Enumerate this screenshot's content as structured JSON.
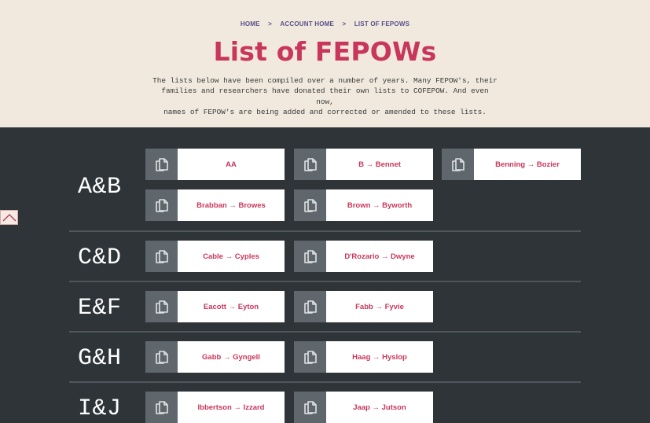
{
  "breadcrumb": {
    "home": "HOME",
    "account": "ACCOUNT HOME",
    "current": "LIST OF FEPOWS",
    "separator": ">"
  },
  "page_title": "List of FEPOWs",
  "intro": {
    "line1": "The lists below have been compiled over a number of years. Many FEPOW's, their",
    "line2": "families and researchers have donated their own lists to COFEPOW. And even now,",
    "line3": "names of FEPOW's are being added and corrected or amended to these lists."
  },
  "sections": [
    {
      "letters": "A&B",
      "lists": [
        "AA",
        "B → Bennet",
        "Benning → Bozier",
        "Brabban → Browes",
        "Brown → Byworth"
      ]
    },
    {
      "letters": "C&D",
      "lists": [
        "Cable → Cyples",
        "D'Rozario → Dwyne"
      ]
    },
    {
      "letters": "E&F",
      "lists": [
        "Eacott → Eyton",
        "Fabb → Fyvie"
      ]
    },
    {
      "letters": "G&H",
      "lists": [
        "Gabb → Gyngell",
        "Haag → Hyslop"
      ]
    },
    {
      "letters": "I&J",
      "lists": [
        "Ibbertson → Izzard",
        "Jaap → Jutson"
      ]
    }
  ],
  "icons": {
    "list_card": "documents-icon",
    "scroll_top": "chevron-up-icon"
  },
  "colors": {
    "accent": "#c8365b",
    "header_bg": "#f1e9dd",
    "page_bg": "#2f3438",
    "icon_bg": "#5f676c",
    "breadcrumb": "#5a4f8a"
  }
}
